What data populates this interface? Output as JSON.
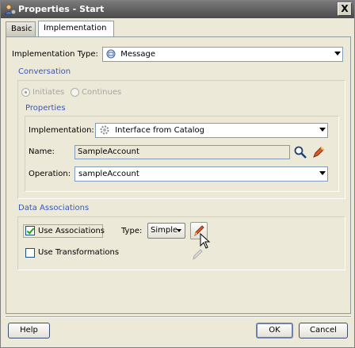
{
  "window": {
    "title": "Properties - Start",
    "close_glyph": "X"
  },
  "tabs": [
    {
      "label": "Basic"
    },
    {
      "label": "Implementation"
    }
  ],
  "implementation_type": {
    "label": "Implementation Type:",
    "value": "Message"
  },
  "conversation": {
    "title": "Conversation",
    "initiates_label": "Initiates",
    "continues_label": "Continues"
  },
  "properties": {
    "title": "Properties",
    "implementation_label": "Implementation:",
    "implementation_value": "Interface from Catalog",
    "name_label": "Name:",
    "name_value": "SampleAccount",
    "operation_label": "Operation:",
    "operation_value": "sampleAccount"
  },
  "data_associations": {
    "title": "Data Associations",
    "use_associations_label": "Use Associations",
    "use_associations_checked": true,
    "type_label": "Type:",
    "type_value": "Simple",
    "use_transformations_label": "Use Transformations",
    "use_transformations_checked": false
  },
  "footer": {
    "help_label": "Help",
    "ok_label": "OK",
    "cancel_label": "Cancel"
  },
  "icons": {
    "app": "gear-person-icon",
    "message": "message-icon",
    "catalog": "gear-icon",
    "search": "search-icon",
    "edit": "pencil-icon",
    "cursor": "arrow-cursor-icon"
  }
}
